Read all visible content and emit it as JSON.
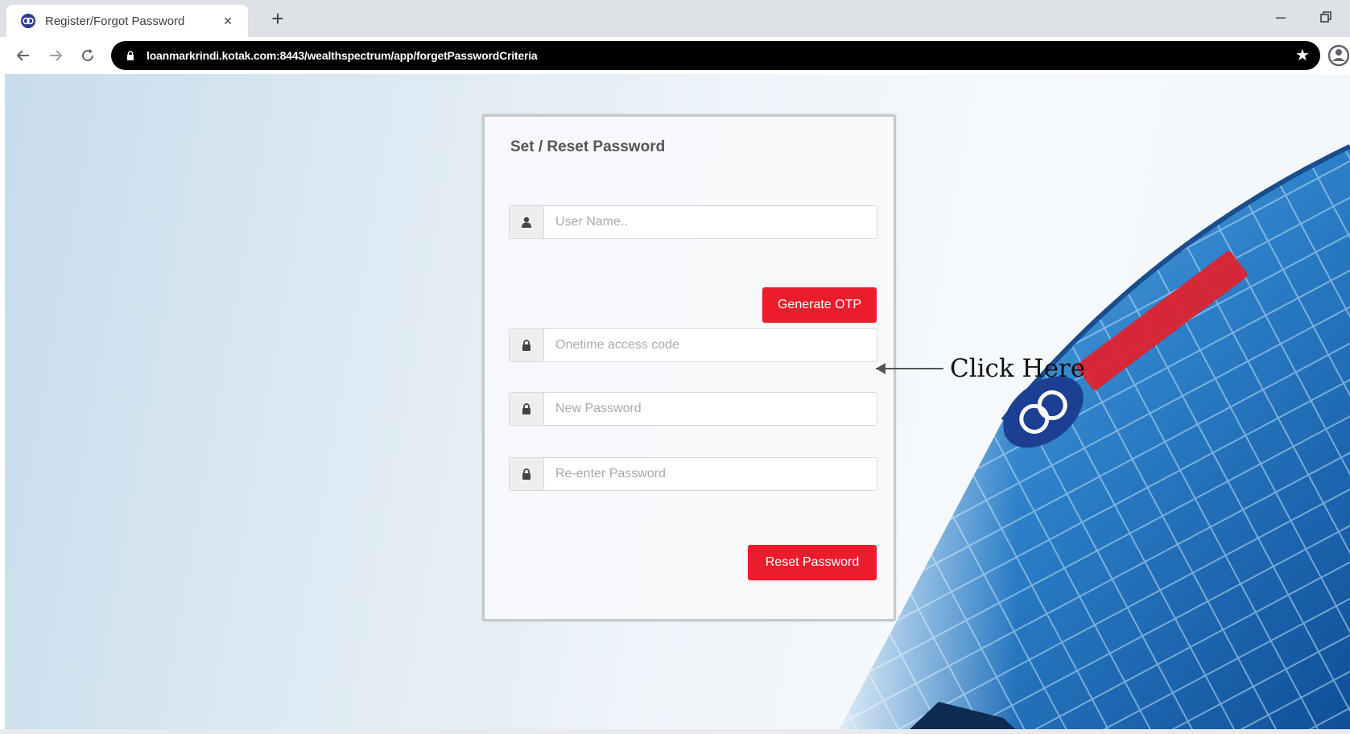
{
  "browser": {
    "tab_title": "Register/Forgot Password",
    "tab_close": "×",
    "new_tab": "+",
    "url": "loanmarkrindi.kotak.com:8443/wealthspectrum/app/forgetPasswordCriteria",
    "minimize": "–"
  },
  "form": {
    "title": "Set / Reset Password",
    "username_placeholder": "User Name..",
    "generate_otp_label": "Generate OTP",
    "otp_placeholder": "Onetime access code",
    "new_password_placeholder": "New Password",
    "reenter_password_placeholder": "Re-enter Password",
    "reset_password_label": "Reset Password"
  },
  "annotation": {
    "text": "Click Here"
  },
  "icons": {
    "user": "user-icon",
    "lock": "lock-icon"
  },
  "colors": {
    "accent_red": "#ec1c2c",
    "kotak_blue": "#1c3f94",
    "kotak_red": "#e3202b"
  }
}
